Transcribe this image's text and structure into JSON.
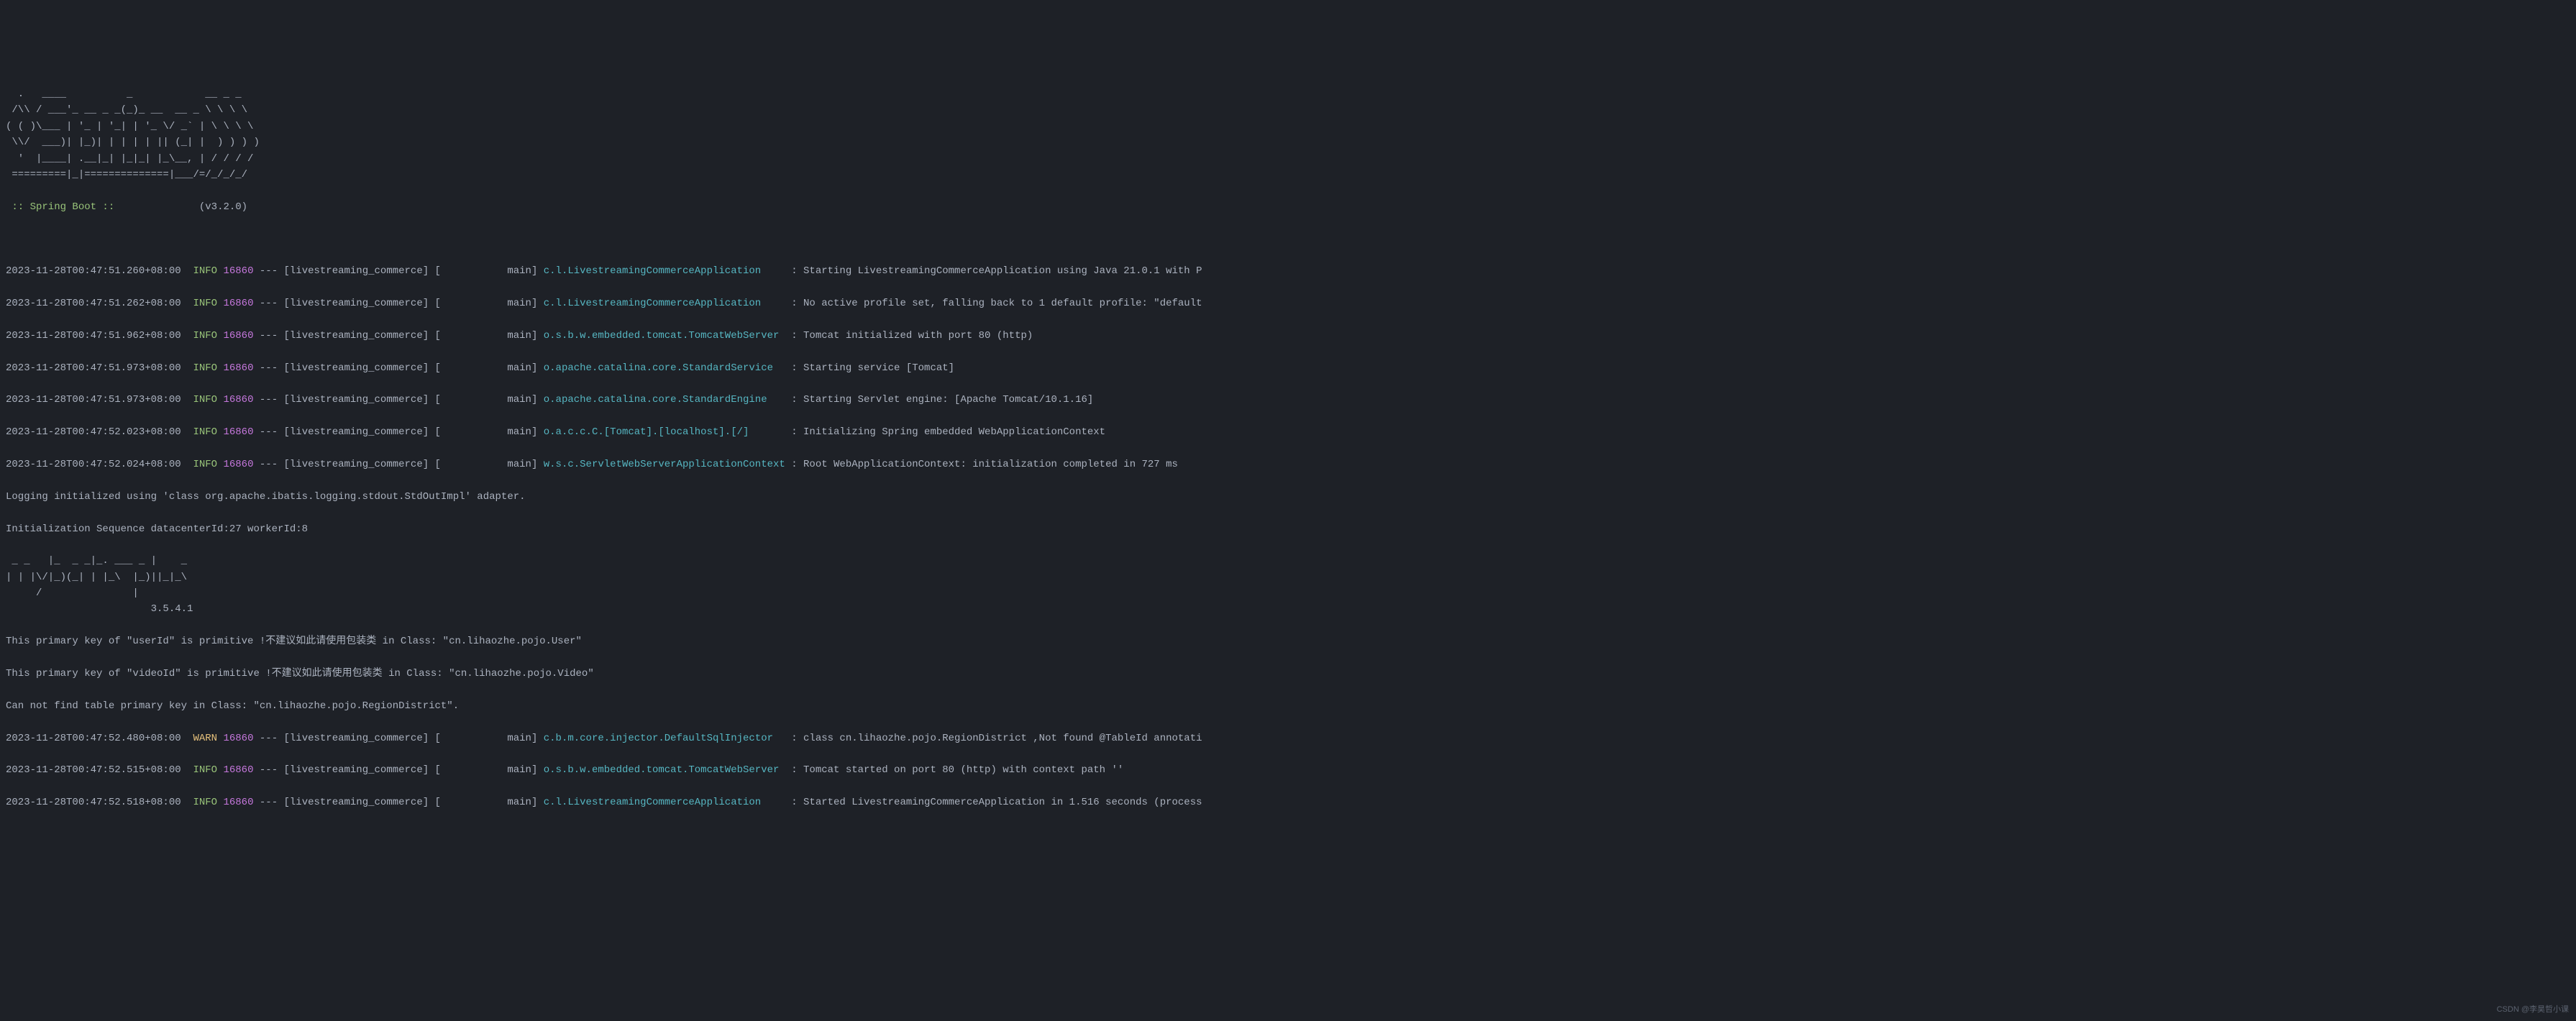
{
  "ascii_banner": {
    "line1": "  .   ____          _            __ _ _",
    "line2": " /\\\\ / ___'_ __ _ _(_)_ __  __ _ \\ \\ \\ \\",
    "line3": "( ( )\\___ | '_ | '_| | '_ \\/ _` | \\ \\ \\ \\",
    "line4": " \\\\/  ___)| |_)| | | | | || (_| |  ) ) ) )",
    "line5": "  '  |____| .__|_| |_|_| |_\\__, | / / / /",
    "line6": " =========|_|==============|___/=/_/_/_/"
  },
  "spring_boot": {
    "label": " :: Spring Boot :: ",
    "version": "             (v3.2.0)"
  },
  "log_lines": [
    {
      "ts": "2023-11-28T00:47:51.260+08:00",
      "level": "INFO",
      "pid": "16860",
      "thread_prefix": " --- [livestreaming_commerce] [           main] ",
      "logger": "c.l.LivestreamingCommerceApplication    ",
      "msg": " : Starting LivestreamingCommerceApplication using Java 21.0.1 with P"
    },
    {
      "ts": "2023-11-28T00:47:51.262+08:00",
      "level": "INFO",
      "pid": "16860",
      "thread_prefix": " --- [livestreaming_commerce] [           main] ",
      "logger": "c.l.LivestreamingCommerceApplication    ",
      "msg": " : No active profile set, falling back to 1 default profile: \"default"
    },
    {
      "ts": "2023-11-28T00:47:51.962+08:00",
      "level": "INFO",
      "pid": "16860",
      "thread_prefix": " --- [livestreaming_commerce] [           main] ",
      "logger": "o.s.b.w.embedded.tomcat.TomcatWebServer ",
      "msg": " : Tomcat initialized with port 80 (http)"
    },
    {
      "ts": "2023-11-28T00:47:51.973+08:00",
      "level": "INFO",
      "pid": "16860",
      "thread_prefix": " --- [livestreaming_commerce] [           main] ",
      "logger": "o.apache.catalina.core.StandardService  ",
      "msg": " : Starting service [Tomcat]"
    },
    {
      "ts": "2023-11-28T00:47:51.973+08:00",
      "level": "INFO",
      "pid": "16860",
      "thread_prefix": " --- [livestreaming_commerce] [           main] ",
      "logger": "o.apache.catalina.core.StandardEngine   ",
      "msg": " : Starting Servlet engine: [Apache Tomcat/10.1.16]"
    },
    {
      "ts": "2023-11-28T00:47:52.023+08:00",
      "level": "INFO",
      "pid": "16860",
      "thread_prefix": " --- [livestreaming_commerce] [           main] ",
      "logger": "o.a.c.c.C.[Tomcat].[localhost].[/]      ",
      "msg": " : Initializing Spring embedded WebApplicationContext"
    },
    {
      "ts": "2023-11-28T00:47:52.024+08:00",
      "level": "INFO",
      "pid": "16860",
      "thread_prefix": " --- [livestreaming_commerce] [           main] ",
      "logger": "w.s.c.ServletWebServerApplicationContext",
      "msg": " : Root WebApplicationContext: initialization completed in 727 ms"
    }
  ],
  "plain_lines": [
    "Logging initialized using 'class org.apache.ibatis.logging.stdout.StdOutImpl' adapter.",
    "Initialization Sequence datacenterId:27 workerId:8"
  ],
  "mybatis_banner": {
    "line1": " _ _   |_  _ _|_. ___ _ |    _ ",
    "line2": "| | |\\/|_)(_| | |_\\  |_)||_|_\\ ",
    "line3": "     /               |         ",
    "line4": "                        3.5.4.1 "
  },
  "warnings_cn": [
    {
      "prefix": "This primary key of \"userId\" is primitive !",
      "cn": "不建议如此请使用包装类",
      "suffix": " in Class: \"cn.lihaozhe.pojo.User\""
    },
    {
      "prefix": "This primary key of \"videoId\" is primitive !",
      "cn": "不建议如此请使用包装类",
      "suffix": " in Class: \"cn.lihaozhe.pojo.Video\""
    }
  ],
  "plain_lines2": [
    "Can not find table primary key in Class: \"cn.lihaozhe.pojo.RegionDistrict\"."
  ],
  "log_lines2": [
    {
      "ts": "2023-11-28T00:47:52.480+08:00",
      "level": "WARN",
      "pid": "16860",
      "thread_prefix": " --- [livestreaming_commerce] [           main] ",
      "logger": "c.b.m.core.injector.DefaultSqlInjector  ",
      "msg": " : class cn.lihaozhe.pojo.RegionDistrict ,Not found @TableId annotati"
    },
    {
      "ts": "2023-11-28T00:47:52.515+08:00",
      "level": "INFO",
      "pid": "16860",
      "thread_prefix": " --- [livestreaming_commerce] [           main] ",
      "logger": "o.s.b.w.embedded.tomcat.TomcatWebServer ",
      "msg": " : Tomcat started on port 80 (http) with context path ''"
    },
    {
      "ts": "2023-11-28T00:47:52.518+08:00",
      "level": "INFO",
      "pid": "16860",
      "thread_prefix": " --- [livestreaming_commerce] [           main] ",
      "logger": "c.l.LivestreamingCommerceApplication    ",
      "msg": " : Started LivestreamingCommerceApplication in 1.516 seconds (process"
    }
  ],
  "watermark": "CSDN @李昊哲小课"
}
